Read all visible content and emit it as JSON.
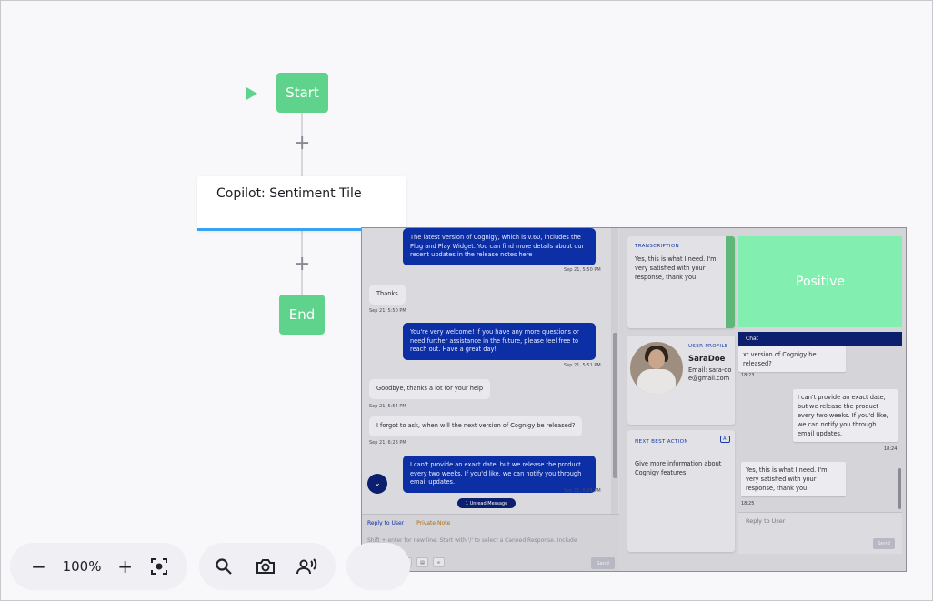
{
  "flow": {
    "start_label": "Start",
    "tile_label": "Copilot: Sentiment Tile",
    "end_label": "End",
    "plus_symbol": "+"
  },
  "toolbar": {
    "zoom_out_symbol": "−",
    "zoom_level": "100%",
    "zoom_in_symbol": "+",
    "icons": [
      "center-focus-icon",
      "search-icon",
      "camera-icon",
      "voice-preview-icon"
    ]
  },
  "embed": {
    "messages": [
      {
        "text": "The latest version of Cognigy, which is v.60, includes the Plug and Play Widget. You can find more details about our recent updates in the release notes here",
        "time": "Sep 21, 5:50 PM",
        "from": "bot"
      },
      {
        "text": "Thanks",
        "time": "Sep 21, 5:50 PM",
        "from": "user"
      },
      {
        "text": "You're very welcome! If you have any more questions or need further assistance in the future, please feel free to reach out. Have a great day!",
        "time": "Sep 21, 5:51 PM",
        "from": "bot"
      },
      {
        "text": "Goodbye, thanks a lot for your help",
        "time": "Sep 21, 5:54 PM",
        "from": "user"
      },
      {
        "text": "I forgot to ask, when will the next version of Cognigy be released?",
        "time": "Sep 21, 6:23 PM",
        "from": "user"
      },
      {
        "text": "I can't provide an exact date, but we release the product every two weeks. If you'd like, we can notify you through email updates.",
        "time": "Sep 21, 6:24 PM",
        "from": "bot"
      }
    ],
    "unread_label": "1 Unread Message",
    "reply_tab": "Reply to User",
    "private_tab": "Private Note",
    "reply_placeholder": "Shift + enter for new line. Start with '/' to select a Canned Response. Include",
    "send_label": "Send",
    "transcription": {
      "title": "TRANSCRIPTION",
      "text": "Yes, this is what I need. I'm very satisfied with your response, thank you!"
    },
    "profile": {
      "title": "USER PROFILE",
      "name": "SaraDoe",
      "email": "Email: sara-doe@gmail.com"
    },
    "nba": {
      "title": "NEXT BEST ACTION",
      "ai_badge": "AI",
      "text": "Give more information about Cognigy features"
    },
    "sentiment_label": "Positive",
    "chat": {
      "header": "Chat",
      "msg1": "xt version of Cognigy be released?",
      "time1": "18:23",
      "msg2": "I can't provide an exact date, but we release the product every two weeks. If you'd like, we can notify you through email updates.",
      "time2": "18:24",
      "msg3": "Yes, this is what I need. I'm very satisfied with your response, thank you!",
      "time3": "18:25",
      "reply_placeholder": "Reply to User",
      "send_label": "Send"
    }
  },
  "colors": {
    "node_green": "#5fd38b",
    "tile_accent": "#3aa3f0",
    "bot_bubble": "#0c2fa6",
    "sentiment_positive": "#82eeb0",
    "chat_header": "#0b1f6e"
  }
}
